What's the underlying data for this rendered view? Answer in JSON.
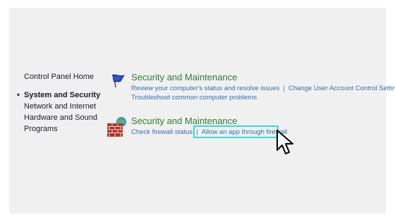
{
  "sidebar": {
    "home": "Control Panel Home",
    "items": [
      {
        "label": "System and Security",
        "active": true
      },
      {
        "label": "Network and Internet",
        "active": false
      },
      {
        "label": "Hardware and Sound",
        "active": false
      },
      {
        "label": "Programs",
        "active": false
      }
    ]
  },
  "sections": [
    {
      "title": "Security and Maintenance",
      "icon": "flag-icon",
      "links": [
        "Review your computer's status and resolve issues",
        "Change User Account Control Settings",
        "Troubleshoot common computer problems"
      ]
    },
    {
      "title": "Security and Maintenance",
      "icon": "firewall-icon",
      "links": [
        "Check firewall status",
        "Allow an app through firewall"
      ]
    }
  ],
  "colors": {
    "background": "#f0f0f0",
    "section_title": "#2e7d32",
    "link": "#2f6fb2",
    "highlight": "#2ee0d0"
  }
}
